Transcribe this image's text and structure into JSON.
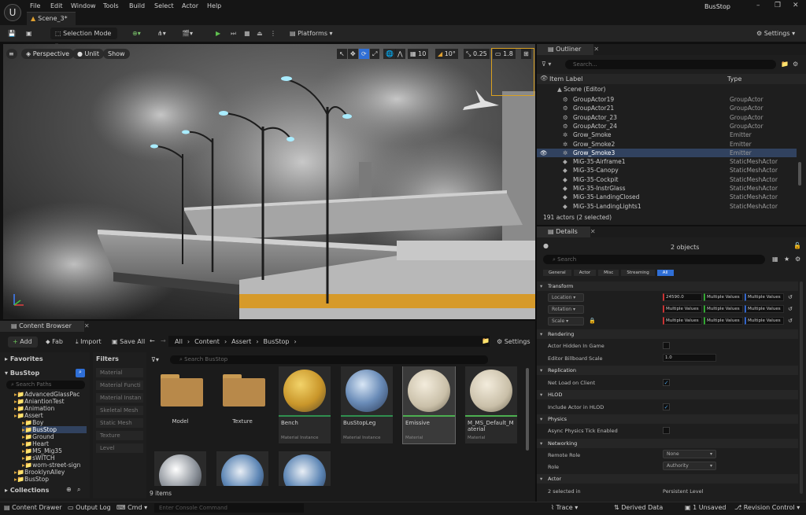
{
  "app": {
    "title": "BusStop",
    "logo": "U"
  },
  "menu": [
    "File",
    "Edit",
    "Window",
    "Tools",
    "Build",
    "Select",
    "Actor",
    "Help"
  ],
  "document_tab": "Scene_3*",
  "toolbar": {
    "selection_mode": "Selection Mode",
    "platforms": "Platforms",
    "settings": "Settings"
  },
  "viewport": {
    "perspective": "Perspective",
    "unlit": "Unlit",
    "show": "Show",
    "grid_snap": "10",
    "rotation_snap": "10°",
    "scale_snap": "0.25",
    "camera_speed": "1.8"
  },
  "outliner": {
    "tab": "Outliner",
    "search_placeholder": "Search...",
    "col_label": "Item Label",
    "col_type": "Type",
    "root": "Scene (Editor)",
    "rows": [
      {
        "label": "GroupActor19",
        "type": "GroupActor",
        "icon": "group-icon"
      },
      {
        "label": "GroupActor21",
        "type": "GroupActor",
        "icon": "group-icon"
      },
      {
        "label": "GroupActor_23",
        "type": "GroupActor",
        "icon": "group-icon"
      },
      {
        "label": "GroupActor_24",
        "type": "GroupActor",
        "icon": "group-icon"
      },
      {
        "label": "Grow_Smoke",
        "type": "Emitter",
        "icon": "emitter-icon"
      },
      {
        "label": "Grow_Smoke2",
        "type": "Emitter",
        "icon": "emitter-icon"
      },
      {
        "label": "Grow_Smoke3",
        "type": "Emitter",
        "icon": "emitter-icon",
        "selected": true
      },
      {
        "label": "MiG-35-Airframe1",
        "type": "StaticMeshActor",
        "icon": "mesh-icon"
      },
      {
        "label": "MiG-35-Canopy",
        "type": "StaticMeshActor",
        "icon": "mesh-icon"
      },
      {
        "label": "MiG-35-Cockpit",
        "type": "StaticMeshActor",
        "icon": "mesh-icon"
      },
      {
        "label": "MiG-35-InstrGlass",
        "type": "StaticMeshActor",
        "icon": "mesh-icon"
      },
      {
        "label": "MiG-35-LandingClosed",
        "type": "StaticMeshActor",
        "icon": "mesh-icon"
      },
      {
        "label": "MiG-35-LandingLights1",
        "type": "StaticMeshActor",
        "icon": "mesh-icon"
      }
    ],
    "footer": "191 actors (2 selected)"
  },
  "details": {
    "tab": "Details",
    "objects": "2 objects",
    "search_placeholder": "Search",
    "filters": [
      "General",
      "Actor",
      "Misc",
      "Streaming",
      "All"
    ],
    "active_filter": "All",
    "sections": {
      "transform": "Transform",
      "rendering": "Rendering",
      "replication": "Replication",
      "hlod": "HLOD",
      "physics": "Physics",
      "networking": "Networking",
      "actor": "Actor"
    },
    "location": {
      "label": "Location",
      "x": "24590.0",
      "y": "Multiple Values",
      "z": "Multiple Values"
    },
    "rotation": {
      "label": "Rotation",
      "x": "Multiple Values",
      "y": "Multiple Values",
      "z": "Multiple Values"
    },
    "scale": {
      "label": "Scale",
      "x": "Multiple Values",
      "y": "Multiple Values",
      "z": "Multiple Values"
    },
    "actor_hidden": "Actor Hidden In Game",
    "billboard_scale": {
      "label": "Editor Billboard Scale",
      "value": "1.0"
    },
    "net_load": "Net Load on Client",
    "include_hlod": "Include Actor in HLOD",
    "async_physics": "Async Physics Tick Enabled",
    "remote_role": {
      "label": "Remote Role",
      "value": "None"
    },
    "role": {
      "label": "Role",
      "value": "Authority"
    },
    "selected_in": {
      "label": "2 selected in",
      "value": "Persistent Level"
    }
  },
  "content_browser": {
    "tab": "Content Browser",
    "add": "Add",
    "fab": "Fab",
    "import": "Import",
    "save_all": "Save All",
    "breadcrumb": [
      "All",
      "Content",
      "Assert",
      "BusStop"
    ],
    "settings": "Settings",
    "favorites": "Favorites",
    "project": "BusStop",
    "search_paths": "Search Paths",
    "tree": [
      {
        "label": "AdvancedGlassPac",
        "depth": 0
      },
      {
        "label": "AniantionTest",
        "depth": 0
      },
      {
        "label": "Animation",
        "depth": 0
      },
      {
        "label": "Assert",
        "depth": 0
      },
      {
        "label": "Boy",
        "depth": 1
      },
      {
        "label": "BusStop",
        "depth": 1,
        "selected": true
      },
      {
        "label": "Ground",
        "depth": 1
      },
      {
        "label": "Heart",
        "depth": 1
      },
      {
        "label": "MS_Mig35",
        "depth": 1
      },
      {
        "label": "sWITCH",
        "depth": 1
      },
      {
        "label": "worn-street-sign",
        "depth": 1
      },
      {
        "label": "BrooklynAlley",
        "depth": 0
      },
      {
        "label": "BusStop",
        "depth": 0
      }
    ],
    "collections": "Collections",
    "filters_title": "Filters",
    "filter_items": [
      "Material",
      "Material Functi",
      "Material Instan",
      "Skeletal Mesh",
      "Static Mesh",
      "Texture",
      "Level"
    ],
    "search_placeholder": "Search BusStop",
    "assets": [
      {
        "name": "Model",
        "kind": "",
        "style": "folder"
      },
      {
        "name": "Texture",
        "kind": "",
        "style": "folder"
      },
      {
        "name": "Bench",
        "kind": "Material Instance",
        "style": "yellow"
      },
      {
        "name": "BusStopLeg",
        "kind": "Material Instance",
        "style": "blue"
      },
      {
        "name": "Emissive",
        "kind": "Material",
        "style": "cream",
        "selected": true
      },
      {
        "name": "M_MS_Default_Material",
        "kind": "Material",
        "style": "cream"
      },
      {
        "name": "",
        "kind": "",
        "style": "chrome"
      },
      {
        "name": "",
        "kind": "",
        "style": "bluecone"
      },
      {
        "name": "",
        "kind": "",
        "style": "bluecone"
      }
    ],
    "item_count": "9 items"
  },
  "statusbar": {
    "content_drawer": "Content Drawer",
    "output_log": "Output Log",
    "cmd": "Cmd",
    "console_placeholder": "Enter Console Command",
    "trace": "Trace",
    "derived_data": "Derived Data",
    "unsaved": "1 Unsaved",
    "revision_control": "Revision Control"
  },
  "colors": {
    "accent": "#2f6fd6",
    "selection": "#31425f",
    "camera_box": "#d9a020"
  }
}
